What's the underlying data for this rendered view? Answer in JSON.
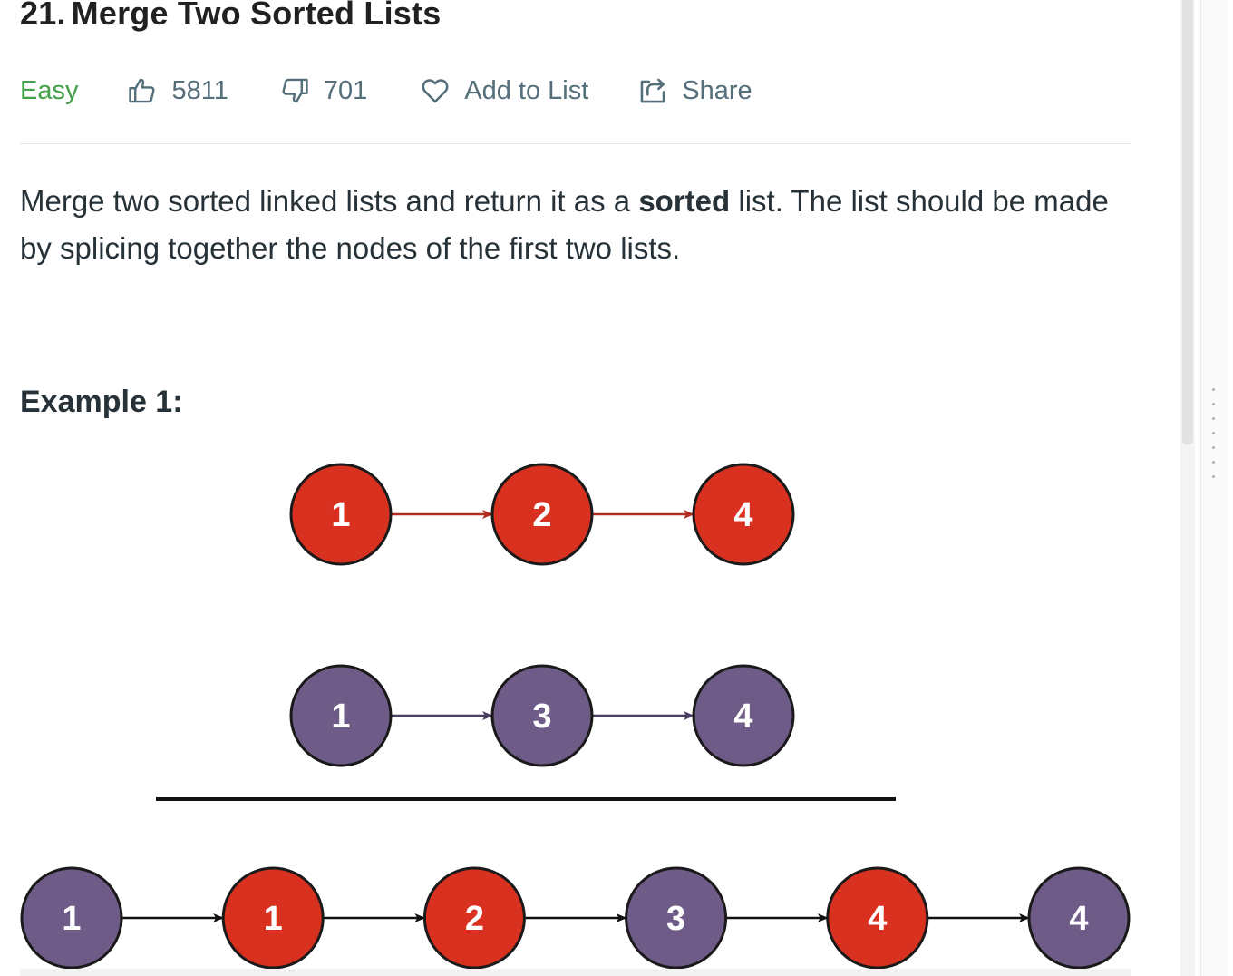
{
  "problem": {
    "number": "21.",
    "title": "Merge Two Sorted Lists",
    "difficulty": "Easy",
    "likes": "5811",
    "dislikes": "701",
    "add_to_list": "Add to List",
    "share": "Share"
  },
  "description": {
    "part1": "Merge two sorted linked lists and return it as a ",
    "bold": "sorted",
    "part2": " list. The list should be made by splicing together the nodes of the first two lists."
  },
  "example": {
    "heading": "Example 1:",
    "list1": [
      "1",
      "2",
      "4"
    ],
    "list2": [
      "1",
      "3",
      "4"
    ],
    "merged": [
      "1",
      "1",
      "2",
      "3",
      "4",
      "4"
    ],
    "merged_source": [
      "list2",
      "list1",
      "list1",
      "list2",
      "list1",
      "list2"
    ]
  },
  "colors": {
    "list1_fill": "#d9311f",
    "list2_fill": "#6e5b87",
    "easy": "#43a047",
    "meta_text": "#546e7a"
  },
  "icons": [
    "thumbs-up-icon",
    "thumbs-down-icon",
    "heart-icon",
    "share-icon"
  ]
}
